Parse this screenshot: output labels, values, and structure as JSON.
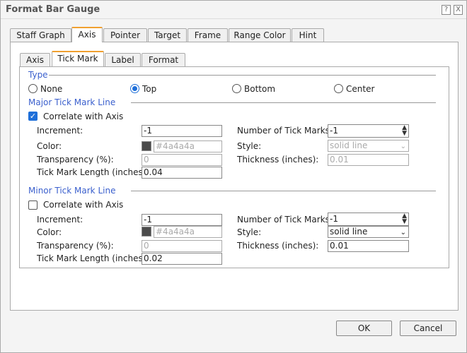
{
  "dialog": {
    "title": "Format Bar Gauge",
    "help": "?",
    "close": "X"
  },
  "tabs": [
    "Staff Graph",
    "Axis",
    "Pointer",
    "Target",
    "Frame",
    "Range Color",
    "Hint"
  ],
  "subtabs": [
    "Axis",
    "Tick Mark",
    "Label",
    "Format"
  ],
  "type": {
    "label": "Type",
    "options": [
      "None",
      "Top",
      "Bottom",
      "Center"
    ],
    "selected": "Top"
  },
  "major": {
    "label": "Major Tick Mark Line",
    "correlate_label": "Correlate with Axis",
    "correlate": true,
    "increment_label": "Increment:",
    "increment": "-1",
    "color_label": "Color:",
    "color": "#4a4a4a",
    "transparency_label": "Transparency (%):",
    "transparency": "0",
    "length_label": "Tick Mark Length (inches):",
    "length": "0.04",
    "ticks_label": "Number of Tick Marks:",
    "ticks": "-1",
    "style_label": "Style:",
    "style": "solid line",
    "thickness_label": "Thickness (inches):",
    "thickness": "0.01"
  },
  "minor": {
    "label": "Minor Tick Mark Line",
    "correlate_label": "Correlate with Axis",
    "correlate": false,
    "increment_label": "Increment:",
    "increment": "-1",
    "color_label": "Color:",
    "color": "#4a4a4a",
    "transparency_label": "Transparency (%):",
    "transparency": "0",
    "length_label": "Tick Mark Length (inches):",
    "length": "0.02",
    "ticks_label": "Number of Tick Marks:",
    "ticks": "-1",
    "style_label": "Style:",
    "style": "solid line",
    "thickness_label": "Thickness (inches):",
    "thickness": "0.01"
  },
  "buttons": {
    "ok": "OK",
    "cancel": "Cancel"
  }
}
